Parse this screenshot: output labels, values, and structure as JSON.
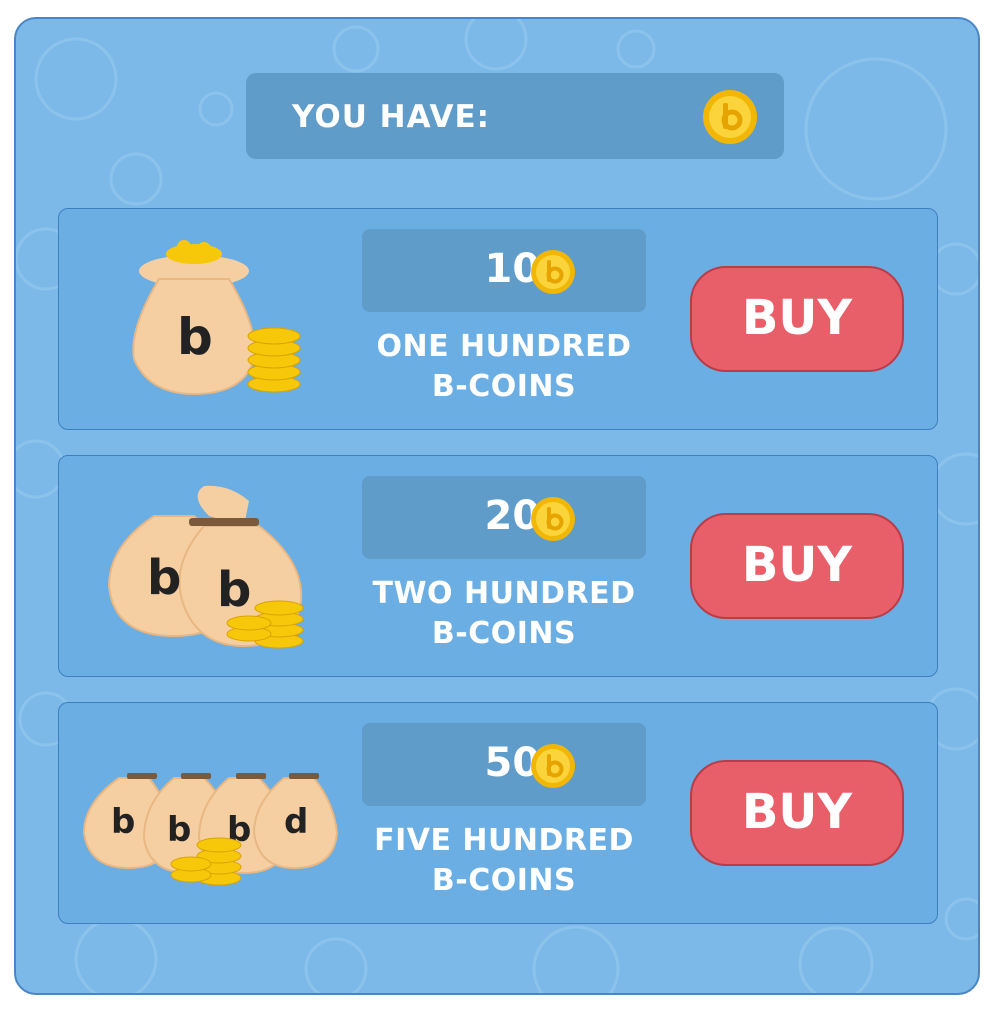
{
  "balance": {
    "label": "YOU HAVE:",
    "coin_icon": "b-coin-icon"
  },
  "packs": [
    {
      "amount": "100",
      "name_line1": "ONE HUNDRED",
      "name_line2": "B-COINS",
      "buy_label": "BUY",
      "illustration": "single-money-bag-icon"
    },
    {
      "amount": "200",
      "name_line1": "TWO HUNDRED",
      "name_line2": "B-COINS",
      "buy_label": "BUY",
      "illustration": "two-money-bags-icon"
    },
    {
      "amount": "500",
      "name_line1": "FIVE HUNDRED",
      "name_line2": "B-COINS",
      "buy_label": "BUY",
      "illustration": "four-money-bags-icon"
    }
  ],
  "colors": {
    "panel": "#7db9e8",
    "card": "#6aaee3",
    "box": "#5f9cc9",
    "buy_button": "#e95f69",
    "coin": "#f7c80a",
    "bag": "#f5cfa2"
  }
}
